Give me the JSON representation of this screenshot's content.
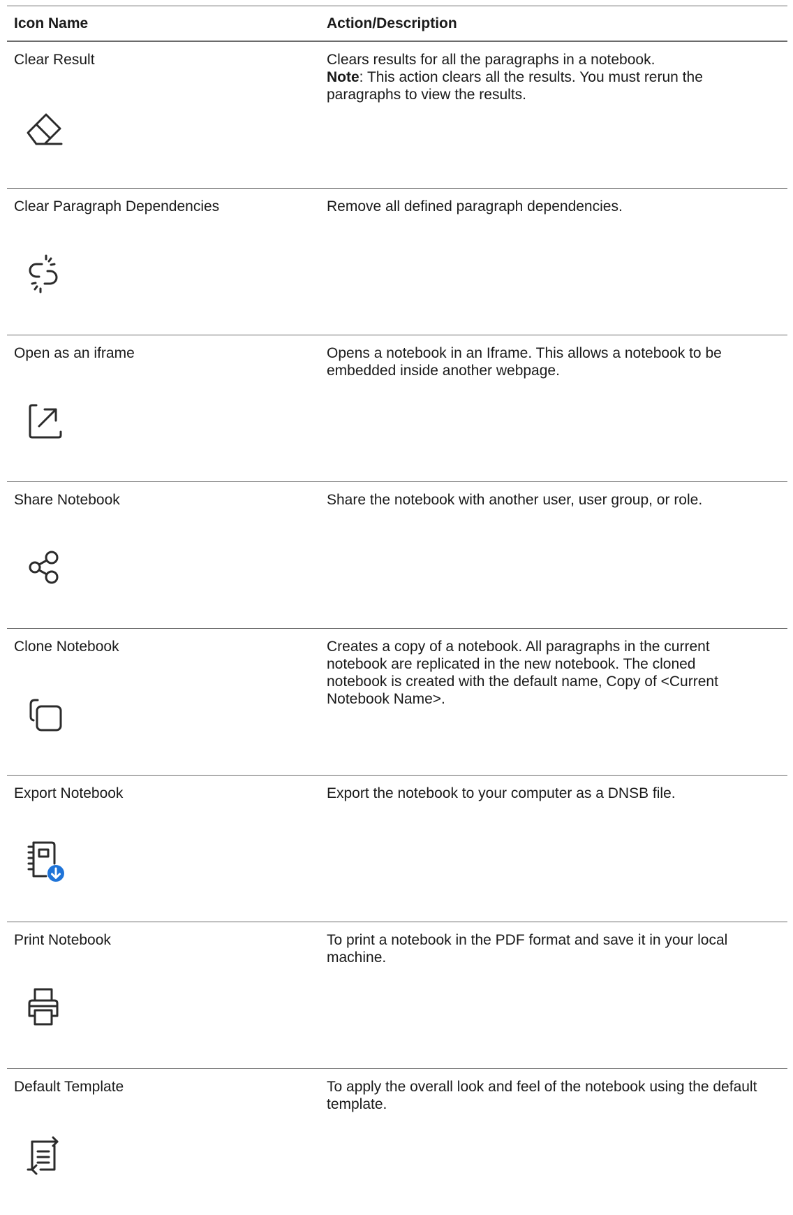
{
  "table": {
    "headers": {
      "name": "Icon Name",
      "action": "Action/Description"
    },
    "rows": [
      {
        "name": "Clear Result",
        "icon": "eraser-icon",
        "desc": "Clears results for all the paragraphs in a notebook.",
        "note_label": "Note",
        "note_text": ": This action clears all the results. You must rerun the paragraphs to view the results."
      },
      {
        "name": "Clear Paragraph Dependencies",
        "icon": "broken-link-icon",
        "desc": "Remove all defined paragraph dependencies."
      },
      {
        "name": "Open as an iframe",
        "icon": "open-external-icon",
        "desc": "Opens a notebook in an Iframe. This allows a notebook to be embedded inside another webpage."
      },
      {
        "name": "Share Notebook",
        "icon": "share-icon",
        "desc": "Share the notebook with another user, user group, or role."
      },
      {
        "name": "Clone Notebook",
        "icon": "copy-icon",
        "desc": "Creates a copy of a notebook. All paragraphs in the current notebook are replicated in the new notebook. The cloned notebook is created with the default name, Copy of <Current Notebook Name>."
      },
      {
        "name": "Export Notebook",
        "icon": "notebook-download-icon",
        "desc": "Export the notebook to your computer as a DNSB file."
      },
      {
        "name": "Print Notebook",
        "icon": "printer-icon",
        "desc": "To print a notebook in the PDF format and save it in your local machine."
      },
      {
        "name": "Default Template",
        "icon": "template-swap-icon",
        "desc": "To apply the overall look and feel of the notebook using the default template."
      }
    ]
  },
  "colors": {
    "text": "#1a1a1a",
    "rule": "#6b6b6b",
    "icon_stroke": "#2b2b2b",
    "accent_blue": "#1f74d8"
  }
}
